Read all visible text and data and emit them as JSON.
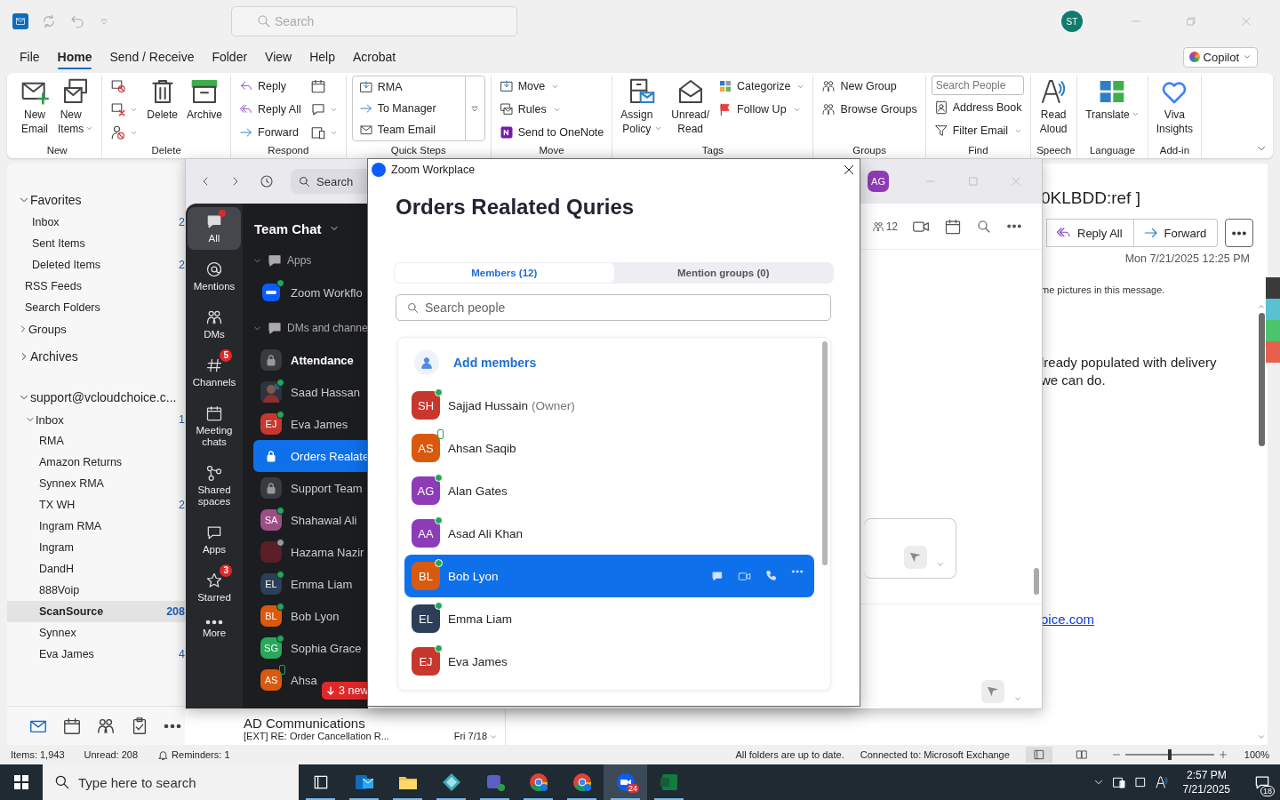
{
  "outlook": {
    "title_bar": {
      "search_placeholder": "Search",
      "avatar": "ST"
    },
    "menu_tabs": [
      {
        "label": "File",
        "selected": false
      },
      {
        "label": "Home",
        "selected": true
      },
      {
        "label": "Send / Receive",
        "selected": false
      },
      {
        "label": "Folder",
        "selected": false
      },
      {
        "label": "View",
        "selected": false
      },
      {
        "label": "Help",
        "selected": false
      },
      {
        "label": "Acrobat",
        "selected": false
      }
    ],
    "copilot": "Copilot",
    "ribbon": [
      {
        "label": "New",
        "kind": "standard",
        "items": [
          {
            "kind": "large",
            "label": "New Email",
            "dropdown": false
          },
          {
            "kind": "large",
            "label": "New Items",
            "dropdown": true
          }
        ]
      },
      {
        "label": "Delete",
        "kind": "standard",
        "items": [
          {
            "kind": "icon",
            "dropdown": false
          },
          {
            "kind": "icon",
            "dropdown": true
          },
          {
            "kind": "icon",
            "dropdown": true
          },
          {
            "kind": "large",
            "label": "Delete",
            "dropdown": false
          },
          {
            "kind": "large",
            "label": "Archive",
            "dropdown": false
          }
        ]
      },
      {
        "label": "Respond",
        "kind": "standard",
        "items": [
          {
            "kind": "small",
            "label": "Reply",
            "dropdown": false
          },
          {
            "kind": "small",
            "label": "Reply All",
            "dropdown": false
          },
          {
            "kind": "small",
            "label": "Forward",
            "dropdown": false
          },
          {
            "kind": "icon",
            "dropdown": false
          },
          {
            "kind": "icon",
            "dropdown": true
          },
          {
            "kind": "icon",
            "dropdown": true
          }
        ]
      },
      {
        "label": "Quick Steps",
        "kind": "gallery",
        "items": [
          {
            "kind": "small",
            "label": "RMA",
            "dropdown": false
          },
          {
            "kind": "small",
            "label": "To Manager",
            "dropdown": false
          },
          {
            "kind": "small",
            "label": "Team Email",
            "dropdown": false
          }
        ]
      },
      {
        "label": "Move",
        "kind": "standard",
        "items": [
          {
            "kind": "small",
            "label": "Move",
            "dropdown": true
          },
          {
            "kind": "small",
            "label": "Rules",
            "dropdown": true
          },
          {
            "kind": "small",
            "label": "Send to OneNote",
            "dropdown": false
          }
        ]
      },
      {
        "label": "Tags",
        "kind": "standard",
        "items": [
          {
            "kind": "large",
            "label": "Assign Policy",
            "dropdown": true
          },
          {
            "kind": "large",
            "label": "Unread/ Read",
            "dropdown": false
          },
          {
            "kind": "small",
            "label": "Categorize",
            "dropdown": true
          },
          {
            "kind": "small",
            "label": "Follow Up",
            "dropdown": true
          }
        ]
      },
      {
        "label": "Groups",
        "kind": "standard",
        "items": [
          {
            "kind": "small",
            "label": "New Group",
            "dropdown": false
          },
          {
            "kind": "small",
            "label": "Browse Groups",
            "dropdown": false
          }
        ]
      },
      {
        "label": "Find",
        "kind": "standard",
        "items": [
          {
            "kind": "search",
            "placeholder": "Search People"
          },
          {
            "kind": "small",
            "label": "Address Book",
            "dropdown": false
          },
          {
            "kind": "small",
            "label": "Filter Email",
            "dropdown": true
          }
        ]
      },
      {
        "label": "Speech",
        "kind": "standard",
        "items": [
          {
            "kind": "large",
            "label": "Read Aloud",
            "dropdown": false
          }
        ]
      },
      {
        "label": "Language",
        "kind": "standard",
        "items": [
          {
            "kind": "large",
            "label": "Translate",
            "dropdown": true
          }
        ]
      },
      {
        "label": "Add-in",
        "kind": "standard",
        "items": [
          {
            "kind": "large",
            "label": "Viva Insights",
            "dropdown": false
          }
        ]
      }
    ],
    "nav": [
      {
        "kind": "section",
        "label": "Favorites",
        "expanded": true,
        "children": [
          {
            "kind": "folder",
            "label": "Inbox",
            "count": "2",
            "selected": false
          },
          {
            "kind": "folder",
            "label": "Sent Items",
            "selected": false
          },
          {
            "kind": "folder",
            "label": "Deleted Items",
            "count": "2",
            "selected": false
          }
        ]
      },
      {
        "kind": "folder",
        "label": "RSS Feeds",
        "selected": false
      },
      {
        "kind": "folder",
        "label": "Search Folders",
        "selected": false
      },
      {
        "kind": "group",
        "label": "Groups",
        "expanded": false
      },
      {
        "kind": "section",
        "label": "Archives",
        "expanded": false
      },
      {
        "kind": "section",
        "label": "support@vcloudchoice.c...",
        "expanded": true,
        "children": [
          {
            "kind": "group",
            "label": "Inbox",
            "count": "1",
            "expanded": true,
            "children": [
              {
                "kind": "folder",
                "label": "RMA",
                "selected": false
              },
              {
                "kind": "folder",
                "label": "Amazon Returns",
                "selected": false
              },
              {
                "kind": "folder",
                "label": "Synnex RMA",
                "selected": false
              },
              {
                "kind": "folder",
                "label": "TX WH",
                "count": "2",
                "selected": false
              },
              {
                "kind": "folder",
                "label": "Ingram RMA",
                "selected": false
              },
              {
                "kind": "folder",
                "label": "Ingram",
                "selected": false
              },
              {
                "kind": "folder",
                "label": "DandH",
                "selected": false
              },
              {
                "kind": "folder",
                "label": "888Voip",
                "selected": false
              },
              {
                "kind": "folder",
                "label": "ScanSource",
                "count": "208",
                "selected": true
              },
              {
                "kind": "folder",
                "label": "Synnex",
                "selected": false
              },
              {
                "kind": "folder",
                "label": "Eva James",
                "count": "4",
                "selected": false
              }
            ]
          }
        ]
      }
    ],
    "message": {
      "sender": "AD Communications",
      "subject": "[EXT] RE: Order Cancellation R...",
      "date": "Fri 7/18"
    },
    "reading_pane": {
      "subject": "0KLBDD:ref ]",
      "buttons": [
        "Reply All",
        "Forward"
      ],
      "date": "Mon 7/21/2025 12:25 PM",
      "info": "me pictures in this message.",
      "body": [
        "lready populated with delivery",
        "we can do."
      ],
      "link": "oice.com"
    },
    "status_bar": {
      "items": "Items: 1,943",
      "unread": "Unread: 208",
      "reminders": "Reminders: 1",
      "sync": "All folders are up to date.",
      "connection": "Connected to: Microsoft Exchange",
      "zoom": {
        "level": 0.5,
        "reading": "100%"
      }
    }
  },
  "zoom_main": {
    "search": "Search",
    "avatar": {
      "initials": "AG",
      "color": "#8e3bb8"
    },
    "nav": [
      {
        "label": "All",
        "selected": true,
        "alert_dot": true
      },
      {
        "label": "Mentions",
        "selected": false,
        "alert_dot": false
      },
      {
        "label": "DMs",
        "selected": false,
        "alert_dot": false
      },
      {
        "label": "Channels",
        "selected": false,
        "alert_dot": false,
        "badge": "5"
      },
      {
        "label": "Meeting chats",
        "selected": false,
        "alert_dot": false
      },
      {
        "label": "Shared spaces",
        "selected": false,
        "alert_dot": false
      },
      {
        "label": "Apps",
        "selected": false,
        "alert_dot": false
      },
      {
        "label": "Starred",
        "selected": false,
        "alert_dot": false,
        "badge": "3"
      },
      {
        "label": "More",
        "selected": false,
        "alert_dot": false
      }
    ],
    "chat_list": {
      "title": "Team Chat",
      "sections": [
        {
          "label": "Apps",
          "expanded": true,
          "items": [
            {
              "kind": "app",
              "name": "Zoom Workflo",
              "online": true,
              "away": false,
              "on_mobile": false,
              "unread": false,
              "selected": false
            }
          ]
        },
        {
          "label": "DMs and channe",
          "expanded": true,
          "items": [
            {
              "kind": "channel",
              "name": "Attendance",
              "online": false,
              "away": false,
              "on_mobile": false,
              "unread": true,
              "selected": false
            },
            {
              "name": "Saad Hassan",
              "online": true,
              "away": false,
              "on_mobile": false,
              "unread": false,
              "selected": false
            },
            {
              "kind": "person",
              "name": "Eva James",
              "initials": "EJ",
              "color": "#c8372d",
              "online": true,
              "away": false,
              "on_mobile": false,
              "unread": false,
              "selected": false
            },
            {
              "kind": "channel",
              "name": "Orders Realate",
              "online": false,
              "away": false,
              "on_mobile": false,
              "unread": false,
              "selected": true
            },
            {
              "kind": "channel",
              "name": "Support Team",
              "online": false,
              "away": false,
              "on_mobile": false,
              "unread": false,
              "selected": false
            },
            {
              "kind": "person",
              "name": "Shahawal Ali",
              "initials": "SA",
              "color": "#9b4f86",
              "online": true,
              "away": false,
              "on_mobile": false,
              "unread": false,
              "selected": false
            },
            {
              "kind": "person",
              "name": "Hazama Nazir",
              "color": "#5a1f28",
              "online": false,
              "away": true,
              "on_mobile": false,
              "unread": false,
              "selected": false
            },
            {
              "kind": "person",
              "name": "Emma Liam",
              "initials": "EL",
              "color": "#2c3e58",
              "online": true,
              "away": false,
              "on_mobile": false,
              "unread": false,
              "selected": false
            },
            {
              "kind": "person",
              "name": "Bob Lyon",
              "initials": "BL",
              "color": "#d9590e",
              "online": true,
              "away": false,
              "on_mobile": false,
              "unread": false,
              "selected": false
            },
            {
              "kind": "person",
              "name": "Sophia Grace",
              "initials": "SG",
              "color": "#27a85a",
              "online": true,
              "away": false,
              "on_mobile": false,
              "unread": false,
              "selected": false
            },
            {
              "kind": "person",
              "name": "Ahsa",
              "initials": "AS",
              "color": "#d9590e",
              "online": false,
              "away": false,
              "on_mobile": true,
              "unread": false,
              "selected": false
            }
          ]
        }
      ],
      "new_badge": "3 new"
    },
    "chat_header": {
      "member_count": "12"
    }
  },
  "dialog": {
    "app": "Zoom Workplace",
    "title": "Orders Realated Quries",
    "tabs": [
      {
        "label": "Members (12)",
        "selected": true
      },
      {
        "label": "Mention groups (0)",
        "selected": false
      }
    ],
    "search_placeholder": "Search people",
    "add_label": "Add members",
    "members": [
      {
        "initials": "SH",
        "name": "Sajjad Hussain",
        "role": "(Owner)",
        "color": "#c8372d",
        "online": true,
        "on_mobile": false,
        "selected": false
      },
      {
        "initials": "AS",
        "name": "Ahsan Saqib",
        "color": "#d9590e",
        "online": false,
        "on_mobile": true,
        "selected": false
      },
      {
        "initials": "AG",
        "name": "Alan Gates",
        "color": "#8e3bb8",
        "online": true,
        "on_mobile": false,
        "selected": false
      },
      {
        "initials": "AA",
        "name": "Asad Ali Khan",
        "color": "#8e3bb8",
        "online": true,
        "on_mobile": false,
        "selected": false
      },
      {
        "initials": "BL",
        "name": "Bob Lyon",
        "color": "#d9590e",
        "online": true,
        "on_mobile": false,
        "selected": true
      },
      {
        "initials": "EL",
        "name": "Emma Liam",
        "color": "#2c3e58",
        "online": true,
        "on_mobile": false,
        "selected": false
      },
      {
        "initials": "EJ",
        "name": "Eva James",
        "color": "#c8372d",
        "online": true,
        "on_mobile": false,
        "selected": false
      }
    ]
  },
  "taskbar": {
    "search_placeholder": "Type here to search",
    "apps": [
      {
        "kind": "outlook",
        "active": false
      },
      {
        "kind": "explorer",
        "active": false
      },
      {
        "kind": "diamond",
        "active": false
      },
      {
        "kind": "teams",
        "active": false
      },
      {
        "kind": "chrome",
        "active": false
      },
      {
        "kind": "chrome",
        "active": false
      },
      {
        "kind": "zoom",
        "active": true,
        "badge": "24"
      },
      {
        "kind": "excel",
        "active": false
      }
    ],
    "time": "2:57 PM",
    "date": "7/21/2025",
    "notifications": "18"
  }
}
